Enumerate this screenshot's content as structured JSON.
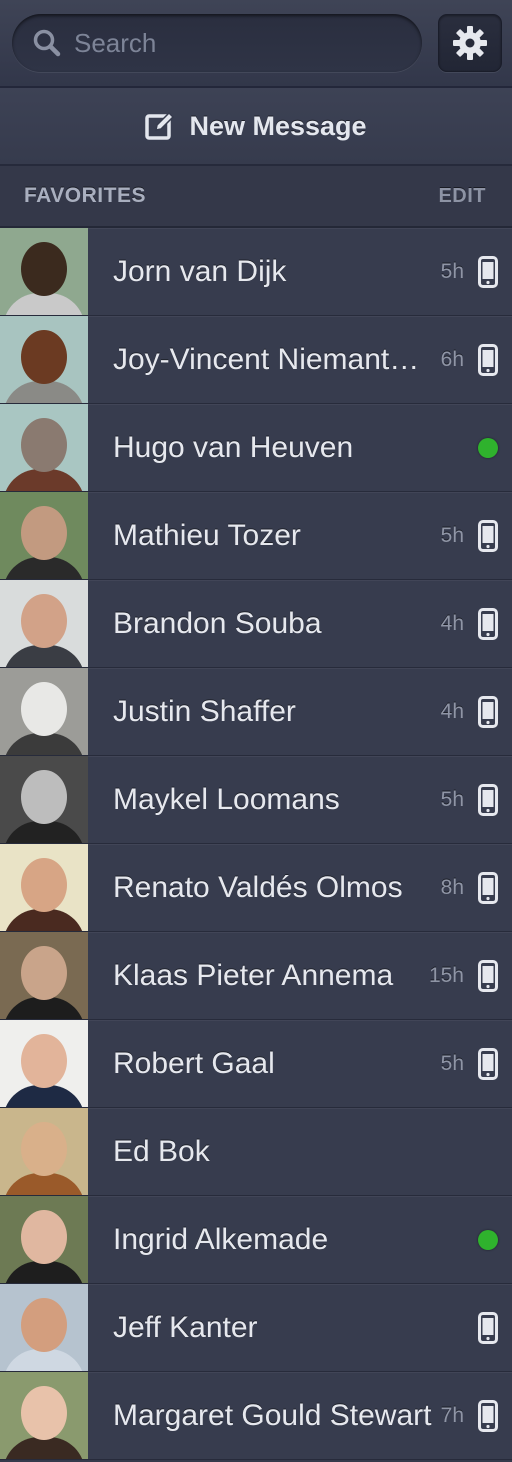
{
  "search": {
    "placeholder": "Search"
  },
  "new_message": {
    "label": "New Message"
  },
  "favorites": {
    "title": "FAVORITES",
    "edit_label": "EDIT"
  },
  "contacts": [
    {
      "name": "Jorn van Dijk",
      "time": "5h",
      "status": "phone",
      "avatar": {
        "bg": "#8fa88f",
        "head": "#3b2a1e",
        "body": "#c9c9c9"
      }
    },
    {
      "name": "Joy-Vincent Niemantsverdriet",
      "time": "6h",
      "status": "phone",
      "avatar": {
        "bg": "#a8c4c0",
        "head": "#6b3a22",
        "body": "#8a8a86"
      }
    },
    {
      "name": "Hugo van Heuven",
      "time": "",
      "status": "online",
      "avatar": {
        "bg": "#a9c6c2",
        "head": "#8a7a70",
        "body": "#6b3a2a"
      }
    },
    {
      "name": "Mathieu Tozer",
      "time": "5h",
      "status": "phone",
      "avatar": {
        "bg": "#6f8a5e",
        "head": "#c29a80",
        "body": "#2a2a2a"
      }
    },
    {
      "name": "Brandon Souba",
      "time": "4h",
      "status": "phone",
      "avatar": {
        "bg": "#d9dcdc",
        "head": "#d2a288",
        "body": "#3a3d44"
      }
    },
    {
      "name": "Justin Shaffer",
      "time": "4h",
      "status": "phone",
      "avatar": {
        "bg": "#9c9c98",
        "head": "#e8e8e6",
        "body": "#3b3b3b"
      }
    },
    {
      "name": "Maykel Loomans",
      "time": "5h",
      "status": "phone",
      "avatar": {
        "bg": "#4a4a4a",
        "head": "#bdbdbd",
        "body": "#222222"
      }
    },
    {
      "name": "Renato Valdés Olmos",
      "time": "8h",
      "status": "phone",
      "avatar": {
        "bg": "#e9e3c6",
        "head": "#d7a585",
        "body": "#4a2a20"
      }
    },
    {
      "name": "Klaas Pieter Annema",
      "time": "15h",
      "status": "phone",
      "avatar": {
        "bg": "#7a6a52",
        "head": "#c9a48a",
        "body": "#1d1d1d"
      }
    },
    {
      "name": "Robert Gaal",
      "time": "5h",
      "status": "phone",
      "avatar": {
        "bg": "#efefed",
        "head": "#e2b49a",
        "body": "#1e2a44"
      }
    },
    {
      "name": "Ed Bok",
      "time": "",
      "status": "none",
      "avatar": {
        "bg": "#c9b68c",
        "head": "#d9b08a",
        "body": "#9a5a2a"
      }
    },
    {
      "name": "Ingrid Alkemade",
      "time": "",
      "status": "online",
      "avatar": {
        "bg": "#6d7a54",
        "head": "#e0b7a0",
        "body": "#1e1e1e"
      }
    },
    {
      "name": "Jeff Kanter",
      "time": "",
      "status": "phone",
      "avatar": {
        "bg": "#b6c3cf",
        "head": "#d39e7e",
        "body": "#cfd8e2"
      }
    },
    {
      "name": "Margaret Gould Stewart",
      "time": "7h",
      "status": "phone",
      "avatar": {
        "bg": "#8a9a6e",
        "head": "#e8c2aa",
        "body": "#3a2a22"
      }
    }
  ]
}
